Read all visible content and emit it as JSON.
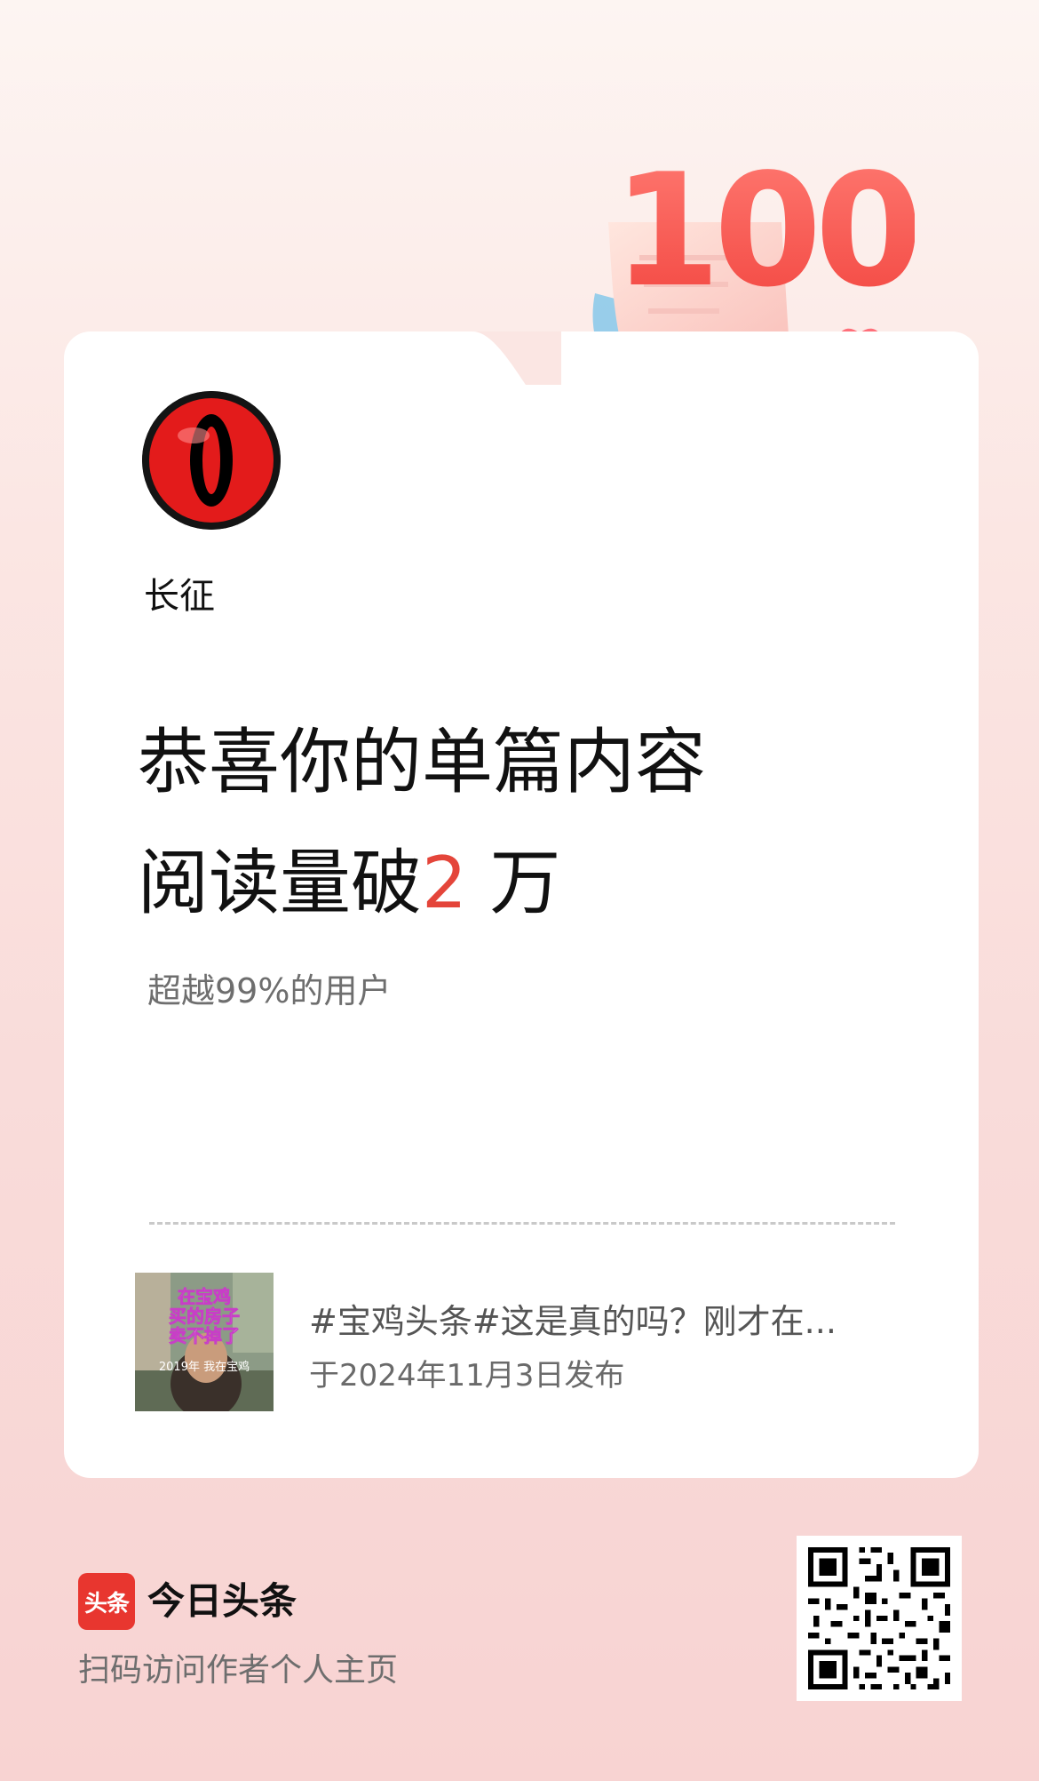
{
  "badge": {
    "number": "100"
  },
  "author": {
    "name": "长征"
  },
  "headline": {
    "line1": "恭喜你的单篇内容",
    "line2_prefix": "阅读量破",
    "line2_number": "2",
    "line2_suffix": " 万"
  },
  "stats": {
    "subtext": "超越99%的用户"
  },
  "article": {
    "thumb_text_1": "在宝鸡",
    "thumb_text_2": "买的房子",
    "thumb_text_3": "卖不掉了",
    "thumb_text_4": "2019年 我在宝鸡",
    "title": "#宝鸡头条#这是真的吗？刚才在...",
    "date": "于2024年11月3日发布"
  },
  "footer": {
    "logo_text": "头条",
    "brand": "今日头条",
    "scan_text": "扫码访问作者个人主页"
  },
  "colors": {
    "accent": "#e4453a",
    "brand_red": "#e8362f"
  }
}
